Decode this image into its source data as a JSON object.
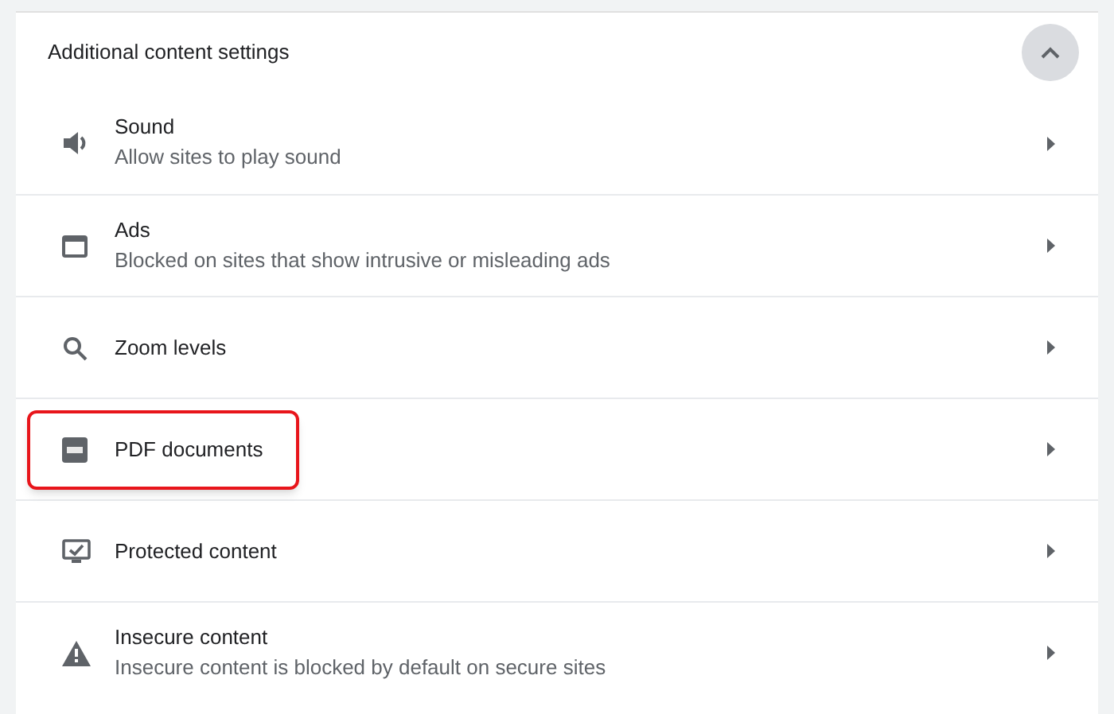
{
  "section": {
    "title": "Additional content settings",
    "expanded": true
  },
  "items": [
    {
      "kind": "sound",
      "title": "Sound",
      "subtitle": "Allow sites to play sound",
      "highlighted": false
    },
    {
      "kind": "ads",
      "title": "Ads",
      "subtitle": "Blocked on sites that show intrusive or misleading ads",
      "highlighted": false
    },
    {
      "kind": "zoom",
      "title": "Zoom levels",
      "highlighted": false
    },
    {
      "kind": "pdf",
      "title": "PDF documents",
      "highlighted": true
    },
    {
      "kind": "protected",
      "title": "Protected content",
      "highlighted": false
    },
    {
      "kind": "insecure",
      "title": "Insecure content",
      "subtitle": "Insecure content is blocked by default on secure sites",
      "highlighted": false
    }
  ]
}
